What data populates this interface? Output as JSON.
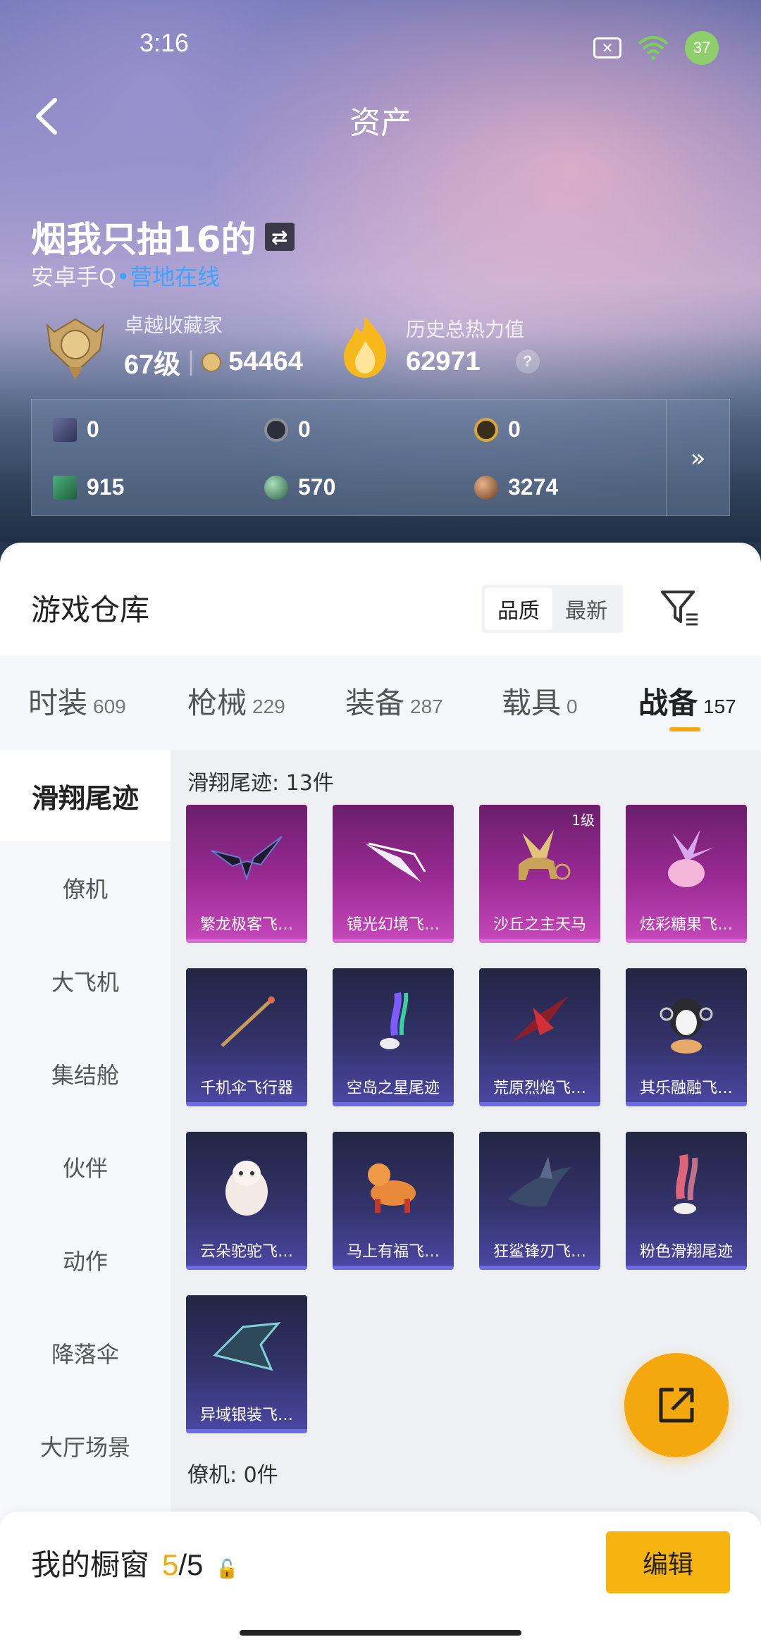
{
  "status_bar": {
    "time": "3:16",
    "battery": "37",
    "wifi_sub": "6"
  },
  "header": {
    "title": "资产"
  },
  "profile": {
    "name": "烟我只抽16的",
    "platform": "安卓手Q",
    "presence": "营地在线",
    "collector_label": "卓越收藏家",
    "collector_level": "67级",
    "collector_points": "54464",
    "heat_label": "历史总热力值",
    "heat_value": "62971",
    "help_glyph": "?"
  },
  "currencies": {
    "row1": [
      {
        "icon": "card-icon",
        "value": "0"
      },
      {
        "icon": "coin-gray-icon",
        "value": "0"
      },
      {
        "icon": "coin-gold-icon",
        "value": "0"
      }
    ],
    "row2": [
      {
        "icon": "ticket-green-icon",
        "value": "915"
      },
      {
        "icon": "orb-green-icon",
        "value": "570"
      },
      {
        "icon": "orb-bronze-icon",
        "value": "3274"
      }
    ],
    "more_glyph": "»"
  },
  "warehouse": {
    "title": "游戏仓库",
    "sort_options": [
      "品质",
      "最新"
    ],
    "tabs": [
      {
        "label": "时装",
        "count": "609"
      },
      {
        "label": "枪械",
        "count": "229"
      },
      {
        "label": "装备",
        "count": "287"
      },
      {
        "label": "载具",
        "count": "0"
      },
      {
        "label": "战备",
        "count": "157"
      }
    ],
    "categories": [
      "滑翔尾迹",
      "僚机",
      "大飞机",
      "集结舱",
      "伙伴",
      "动作",
      "降落伞",
      "大厅场景"
    ],
    "section_title": "滑翔尾迹: 13件",
    "next_section_title": "僚机: 0件",
    "items": [
      {
        "name": "繁龙极客飞…",
        "rarity": "purple",
        "art": "bat-glider-icon",
        "level": ""
      },
      {
        "name": "镜光幻境飞…",
        "rarity": "purple",
        "art": "crystal-wing-icon",
        "level": ""
      },
      {
        "name": "沙丘之主天马",
        "rarity": "purple",
        "art": "pegasus-icon",
        "level": "1级"
      },
      {
        "name": "炫彩糖果飞…",
        "rarity": "purple",
        "art": "candy-icon",
        "level": ""
      },
      {
        "name": "千机伞飞行器",
        "rarity": "blue",
        "art": "umbrella-glider-icon",
        "level": ""
      },
      {
        "name": "空岛之星尾迹",
        "rarity": "blue",
        "art": "rainbow-trail-icon",
        "level": ""
      },
      {
        "name": "荒原烈焰飞…",
        "rarity": "blue",
        "art": "flame-glider-icon",
        "level": ""
      },
      {
        "name": "其乐融融飞…",
        "rarity": "blue",
        "art": "penguin-icon",
        "level": ""
      },
      {
        "name": "云朵驼驼飞…",
        "rarity": "blue",
        "art": "alpaca-icon",
        "level": ""
      },
      {
        "name": "马上有福飞…",
        "rarity": "blue",
        "art": "horse-icon",
        "level": ""
      },
      {
        "name": "狂鲨锋刃飞…",
        "rarity": "blue",
        "art": "shark-icon",
        "level": ""
      },
      {
        "name": "粉色滑翔尾迹",
        "rarity": "blue",
        "art": "pink-trail-icon",
        "level": ""
      },
      {
        "name": "异域银装飞…",
        "rarity": "blue",
        "art": "silver-armor-icon",
        "level": ""
      }
    ]
  },
  "showcase": {
    "title": "我的橱窗",
    "count_current": "5",
    "count_total": "/5",
    "edit_label": "编辑"
  },
  "colors": {
    "accent": "#f5a80e",
    "purple_rarity": "#c447b9",
    "blue_rarity": "#4b46a2",
    "online": "#3da3ff"
  }
}
